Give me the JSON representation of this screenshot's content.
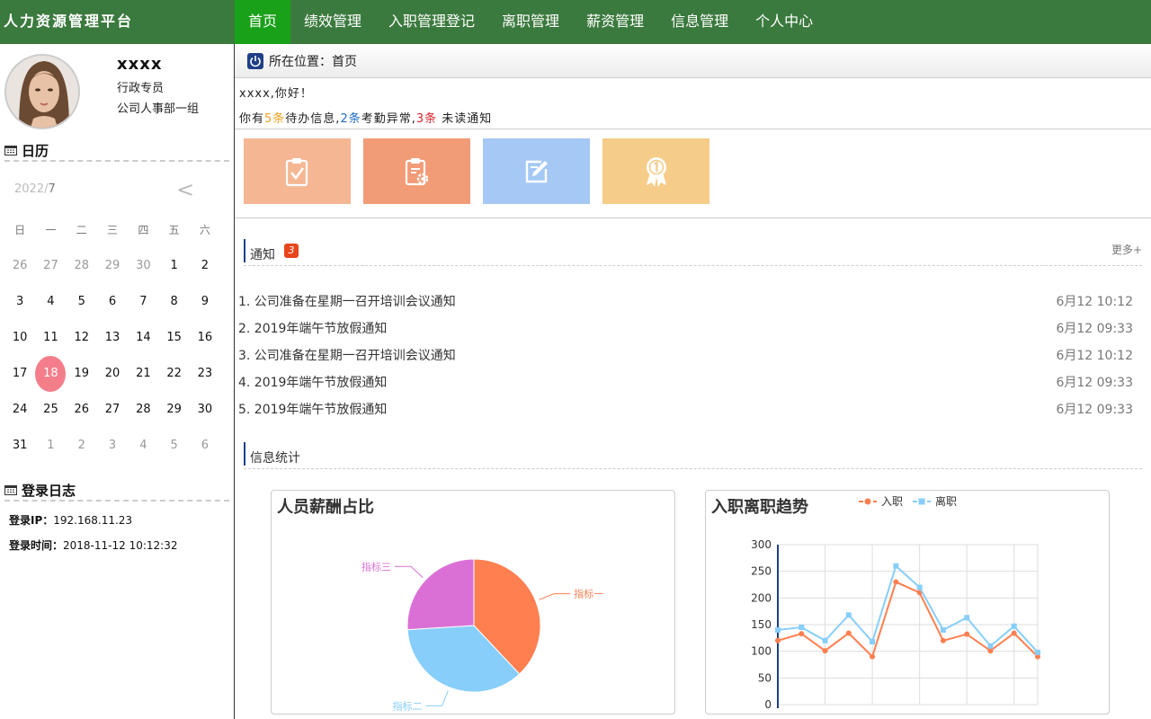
{
  "app": {
    "title": "人力资源管理平台"
  },
  "nav": {
    "items": [
      {
        "label": "首页",
        "active": true
      },
      {
        "label": "绩效管理"
      },
      {
        "label": "入职管理登记"
      },
      {
        "label": "离职管理"
      },
      {
        "label": "薪资管理"
      },
      {
        "label": "信息管理"
      },
      {
        "label": "个人中心"
      }
    ]
  },
  "profile": {
    "name": "xxxx",
    "role": "行政专员",
    "department": "公司人事部一组"
  },
  "calendar": {
    "heading": "日历",
    "year": "2022/",
    "month": "7",
    "prev_label": "<",
    "weekdays": [
      "日",
      "一",
      "二",
      "三",
      "四",
      "五",
      "六"
    ],
    "days": [
      {
        "d": "26",
        "other": true
      },
      {
        "d": "27",
        "other": true
      },
      {
        "d": "28",
        "other": true
      },
      {
        "d": "29",
        "other": true
      },
      {
        "d": "30",
        "other": true
      },
      {
        "d": "1"
      },
      {
        "d": "2"
      },
      {
        "d": "3"
      },
      {
        "d": "4"
      },
      {
        "d": "5"
      },
      {
        "d": "6"
      },
      {
        "d": "7"
      },
      {
        "d": "8"
      },
      {
        "d": "9"
      },
      {
        "d": "10"
      },
      {
        "d": "11"
      },
      {
        "d": "12"
      },
      {
        "d": "13"
      },
      {
        "d": "14"
      },
      {
        "d": "15"
      },
      {
        "d": "16"
      },
      {
        "d": "17"
      },
      {
        "d": "18",
        "today": true
      },
      {
        "d": "19"
      },
      {
        "d": "20"
      },
      {
        "d": "21"
      },
      {
        "d": "22"
      },
      {
        "d": "23"
      },
      {
        "d": "24"
      },
      {
        "d": "25"
      },
      {
        "d": "26"
      },
      {
        "d": "27"
      },
      {
        "d": "28"
      },
      {
        "d": "29"
      },
      {
        "d": "30"
      },
      {
        "d": "31"
      },
      {
        "d": "1",
        "other": true
      },
      {
        "d": "2",
        "other": true
      },
      {
        "d": "3",
        "other": true
      },
      {
        "d": "4",
        "other": true
      },
      {
        "d": "5",
        "other": true
      },
      {
        "d": "6",
        "other": true
      }
    ]
  },
  "login_log": {
    "heading": "登录日志",
    "ip_label": "登录IP：",
    "ip": "192.168.11.23",
    "time_label": "登录时间：",
    "time": "2018-11-12 10:12:32"
  },
  "breadcrumb": {
    "text": "所在位置：首页"
  },
  "welcome": {
    "greeting": "xxxx,你好！"
  },
  "summary": {
    "prefix": "你有",
    "pending_count": "5条",
    "pending_label": "待办信息,",
    "attendance_count": "2条",
    "attendance_label": "考勤异常,",
    "unread_count": "3条",
    "unread_label": " 未读通知"
  },
  "tiles": [
    {
      "icon": "clipboard-check-icon",
      "color": "#f5b793"
    },
    {
      "icon": "clipboard-gear-icon",
      "color": "#f29b77"
    },
    {
      "icon": "edit-icon",
      "color": "#a5c8f5"
    },
    {
      "icon": "award-icon",
      "color": "#f5cc88"
    }
  ],
  "notices": {
    "title": "通知",
    "badge": "3",
    "more": "更多+",
    "items": [
      {
        "title": "1. 公司准备在星期一召开培训会议通知",
        "date": "6月12 10:12"
      },
      {
        "title": "2. 2019年端午节放假通知",
        "date": "6月12 09:33"
      },
      {
        "title": "3. 公司准备在星期一召开培训会议通知",
        "date": "6月12 10:12"
      },
      {
        "title": "4. 2019年端午节放假通知",
        "date": "6月12 09:33"
      },
      {
        "title": "5. 2019年端午节放假通知",
        "date": "6月12 09:33"
      }
    ]
  },
  "stats": {
    "title": "信息统计"
  },
  "chart_data": [
    {
      "type": "pie",
      "title": "人员薪酬占比",
      "slices": [
        {
          "name": "指标一",
          "value": 38,
          "color": "#ff7f50"
        },
        {
          "name": "指标二",
          "value": 36,
          "color": "#87cefa"
        },
        {
          "name": "指标三",
          "value": 26,
          "color": "#da70d6"
        }
      ]
    },
    {
      "type": "line",
      "title": "入职离职趋势",
      "ylim": [
        0,
        300
      ],
      "yticks": [
        0,
        50,
        100,
        150,
        200,
        250,
        300
      ],
      "grid": true,
      "legend": "top",
      "series": [
        {
          "name": "入职",
          "color": "#ff7f50",
          "values": [
            120,
            133,
            101,
            134,
            90,
            230,
            210,
            120,
            132,
            101,
            134,
            90
          ]
        },
        {
          "name": "离职",
          "color": "#87cefa",
          "values": [
            140,
            145,
            120,
            168,
            118,
            260,
            220,
            140,
            163,
            110,
            147,
            98
          ]
        }
      ]
    }
  ]
}
